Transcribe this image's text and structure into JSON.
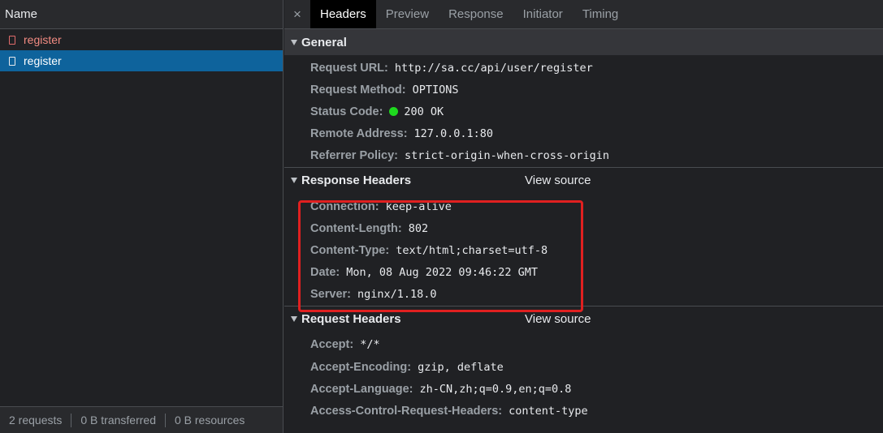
{
  "requests_panel": {
    "column_header": "Name",
    "items": [
      {
        "label": "register",
        "state": "error"
      },
      {
        "label": "register",
        "state": "selected"
      }
    ],
    "status": {
      "requests": "2 requests",
      "transferred": "0 B transferred",
      "resources": "0 B resources"
    }
  },
  "tabs": {
    "close": "×",
    "items": [
      "Headers",
      "Preview",
      "Response",
      "Initiator",
      "Timing"
    ],
    "active": "Headers"
  },
  "general": {
    "title": "General",
    "rows": [
      {
        "key": "Request URL:",
        "value": "http://sa.cc/api/user/register"
      },
      {
        "key": "Request Method:",
        "value": "OPTIONS"
      },
      {
        "key": "Status Code:",
        "value": "200 OK",
        "status_color": "#1ed91e"
      },
      {
        "key": "Remote Address:",
        "value": "127.0.0.1:80"
      },
      {
        "key": "Referrer Policy:",
        "value": "strict-origin-when-cross-origin"
      }
    ]
  },
  "response_headers": {
    "title": "Response Headers",
    "view_source": "View source",
    "rows": [
      {
        "key": "Connection:",
        "value": "keep-alive"
      },
      {
        "key": "Content-Length:",
        "value": "802"
      },
      {
        "key": "Content-Type:",
        "value": "text/html;charset=utf-8"
      },
      {
        "key": "Date:",
        "value": "Mon, 08 Aug 2022 09:46:22 GMT"
      },
      {
        "key": "Server:",
        "value": "nginx/1.18.0"
      }
    ]
  },
  "request_headers": {
    "title": "Request Headers",
    "view_source": "View source",
    "rows": [
      {
        "key": "Accept:",
        "value": "*/*"
      },
      {
        "key": "Accept-Encoding:",
        "value": "gzip, deflate"
      },
      {
        "key": "Accept-Language:",
        "value": "zh-CN,zh;q=0.9,en;q=0.8"
      },
      {
        "key": "Access-Control-Request-Headers:",
        "value": "content-type"
      }
    ]
  },
  "colors": {
    "selected_row": "#0e639c",
    "error_text": "#f28b82",
    "highlight_box": "#e02020"
  }
}
